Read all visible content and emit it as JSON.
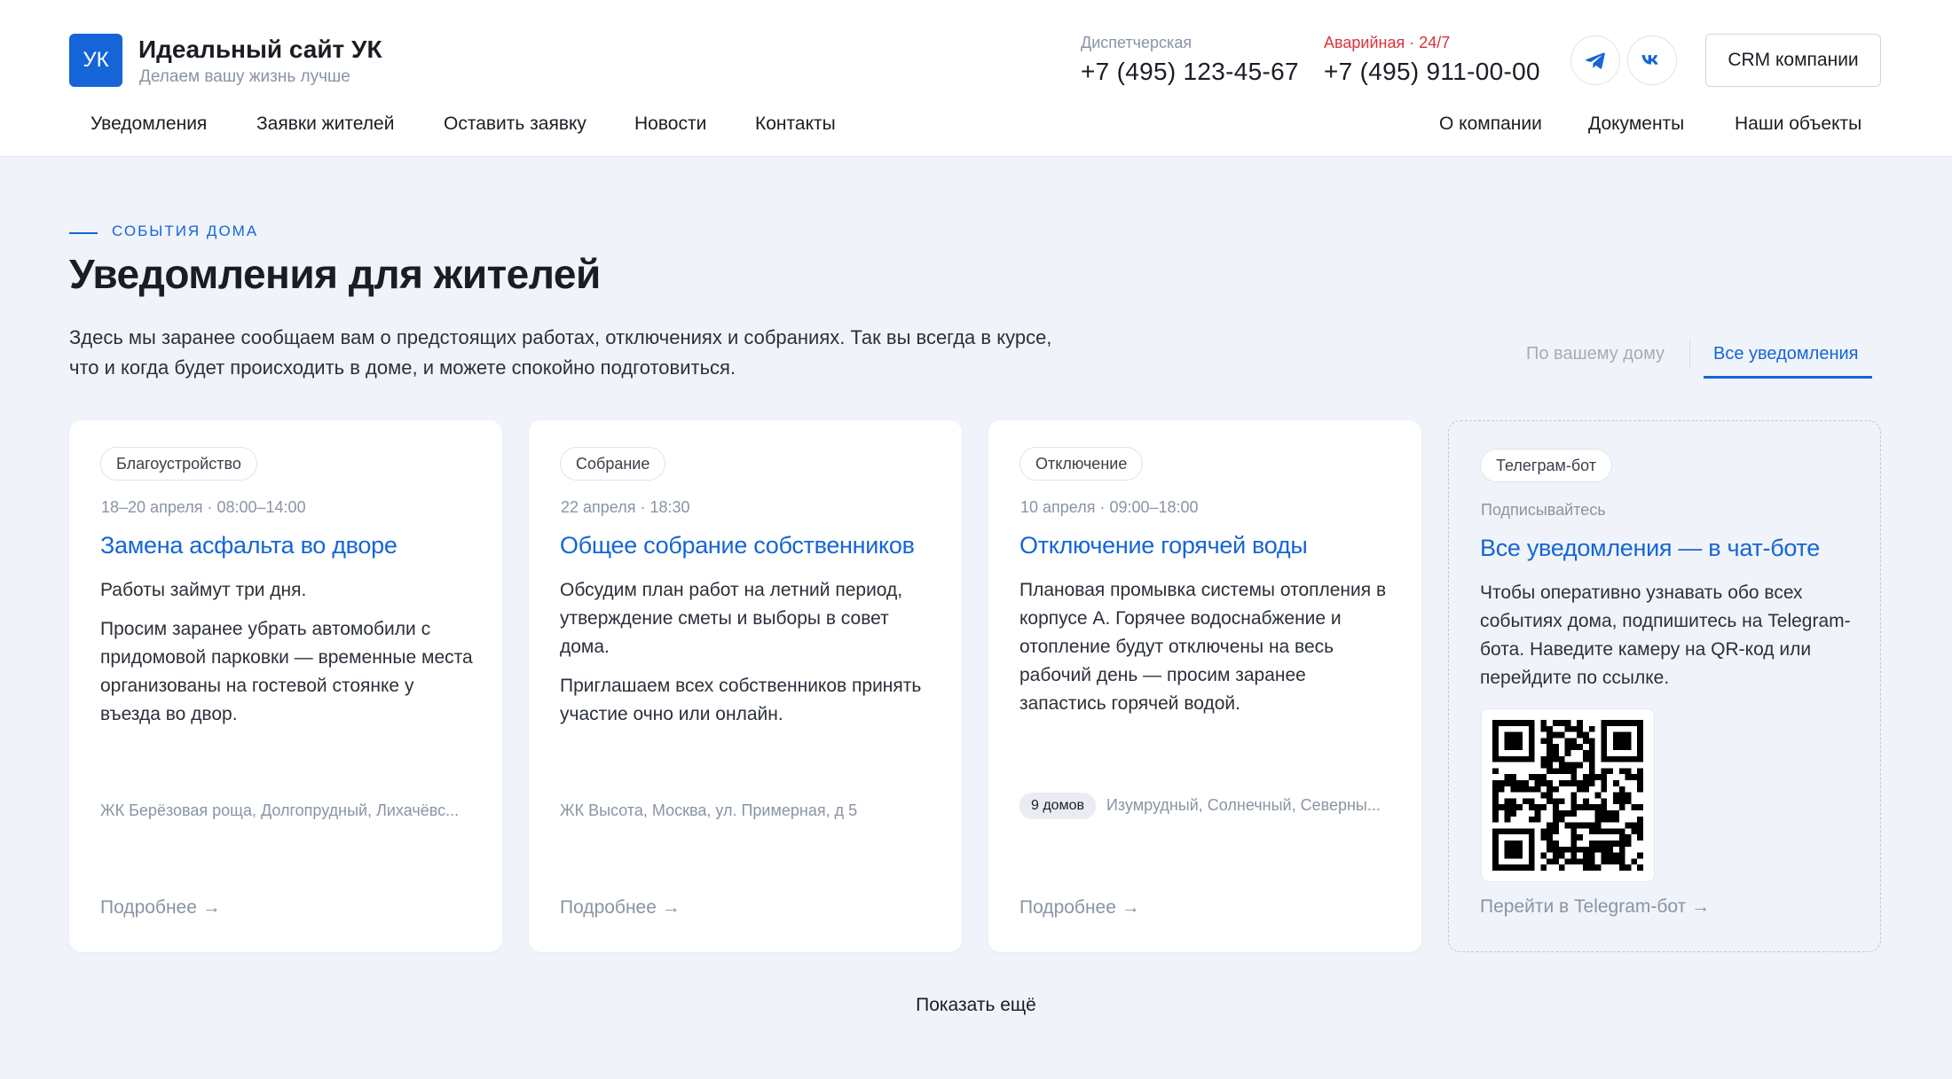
{
  "brand": {
    "logo_text": "УК",
    "title": "Идеальный сайт УК",
    "subtitle": "Делаем вашу жизнь лучше",
    "accent_color": "#1565d8"
  },
  "contacts": {
    "dispatch_label": "Диспетчерская",
    "dispatch_phone": "+7 (495) 123-45-67",
    "emergency_label": "Аварийная · 24/7",
    "emergency_phone": "+7 (495) 911-00-00",
    "emergency_color": "#d9323a"
  },
  "social": [
    {
      "icon": "telegram-icon"
    },
    {
      "icon": "vk-icon"
    }
  ],
  "crm_button": "CRM компании",
  "nav_left": [
    "Уведомления",
    "Заявки жителей",
    "Оставить заявку",
    "Новости",
    "Контакты"
  ],
  "nav_right": [
    "О компании",
    "Документы",
    "Наши объекты"
  ],
  "section": {
    "eyebrow": "СОБЫТИЯ ДОМА",
    "title": "Уведомления для жителей",
    "description": "Здесь мы заранее сообщаем вам о предстоящих работах, отключениях и собраниях. Так вы всегда в курсе, что и когда будет происходить в доме, и можете спокойно подготовиться."
  },
  "tabs": [
    {
      "label": "По вашему дому",
      "active": false
    },
    {
      "label": "Все уведомления",
      "active": true
    }
  ],
  "cards": [
    {
      "tag": "Благоустройство",
      "date": "18–20 апреля · 08:00–14:00",
      "title": "Замена асфальта во дворе",
      "body": [
        "Работы займут три дня.",
        "Просим заранее убрать автомобили с придомовой парковки — временные места организованы на гостевой стоянке у въезда во двор."
      ],
      "location": "ЖК Берёзовая роща, Долгопрудный, Лихачёвс...",
      "more": "Подробнее →"
    },
    {
      "tag": "Собрание",
      "date": "22 апреля · 18:30",
      "title": "Общее собрание собственников",
      "body": [
        "Обсудим план работ на летний период, утверждение сметы и выборы в совет дома.",
        "Приглашаем всех собственников принять участие очно или онлайн."
      ],
      "location": "ЖК Высота, Москва, ул. Примерная, д 5",
      "more": "Подробнее →"
    },
    {
      "tag": "Отключение",
      "date": "10 апреля · 09:00–18:00",
      "title": "Отключение горячей воды",
      "body": [
        "Плановая промывка системы отопления в корпусе А. Горячее водоснабжение и отопление будут отключены на весь рабочий день — просим заранее запастись горячей водой."
      ],
      "count_badge": "9 домов",
      "location": "Изумрудный, Солнечный, Северны...",
      "more": "Подробнее →"
    }
  ],
  "bot_card": {
    "tag": "Телеграм-бот",
    "kicker": "Подписывайтесь",
    "title": "Все уведомления — в чат-боте",
    "body": "Чтобы оперативно узнавать обо всех событиях дома, подпишитесь на Telegram-бота. Наведите камеру на QR-код или перейдите по ссылке.",
    "qr_icon": "qr-code-icon",
    "link": "Перейти в Telegram-бот →"
  },
  "show_more": "Показать ещё"
}
